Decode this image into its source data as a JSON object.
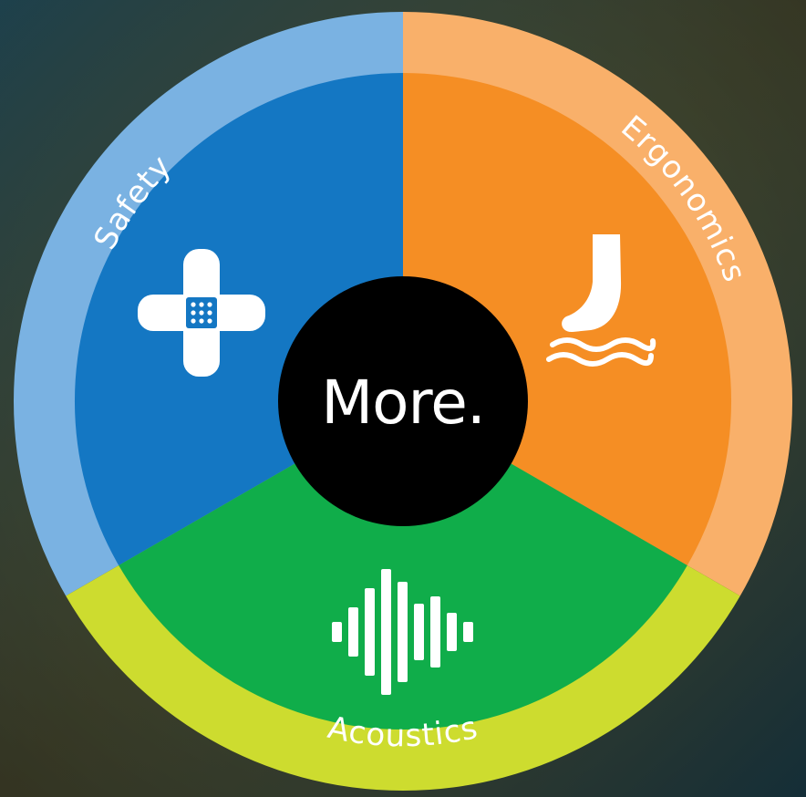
{
  "center": {
    "label": "More."
  },
  "segments": [
    {
      "label": "Safety",
      "icon": "bandage-icon",
      "inner_color": "#1477c3",
      "ring_color": "#7ab2e2"
    },
    {
      "label": "Ergonomics",
      "icon": "foot-icon",
      "inner_color": "#f58e24",
      "ring_color": "#f9b06a"
    },
    {
      "label": "Acoustics",
      "icon": "sound-wave-icon",
      "inner_color": "#10ad4a",
      "ring_color": "#cddc2f"
    }
  ],
  "colors": {
    "center": "#000000",
    "icon": "#ffffff",
    "text": "#ffffff"
  }
}
